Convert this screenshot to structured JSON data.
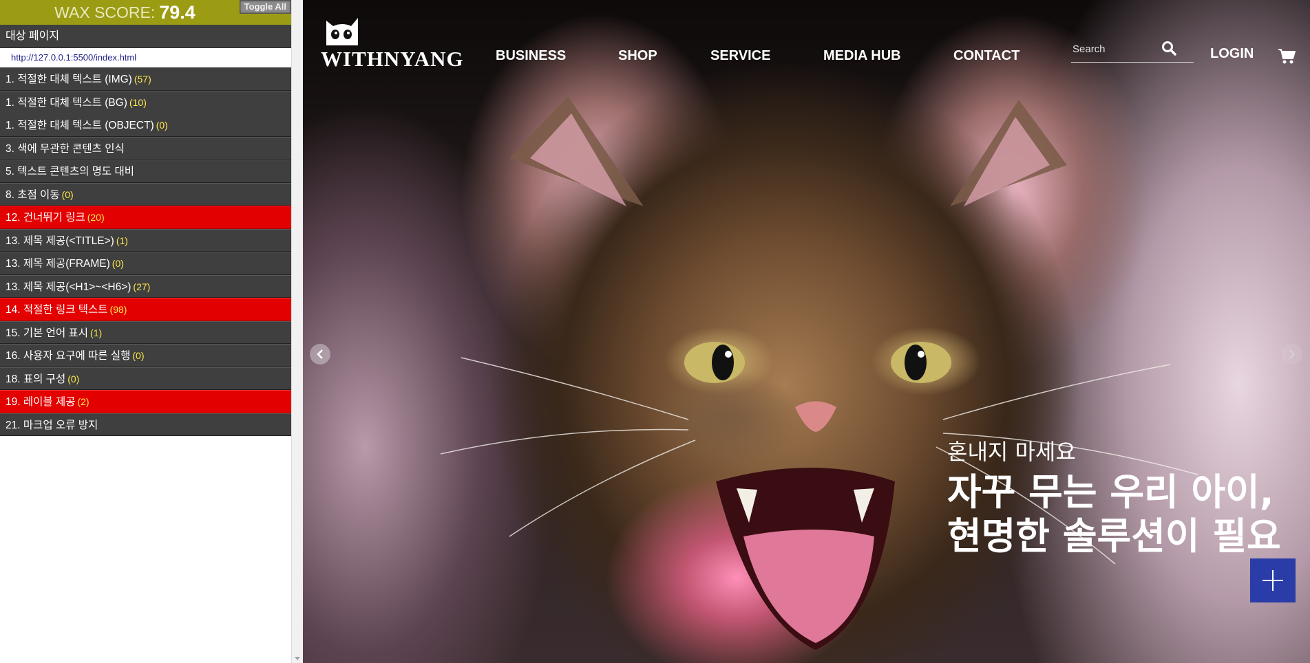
{
  "wax": {
    "score_label": "WAX SCORE:",
    "score_value": "79.4",
    "toggle_all": "Toggle All",
    "target_page_label": "대상 페이지",
    "target_url": "http://127.0.0.1:5500/index.html",
    "items": [
      {
        "label": "1. 적절한 대체 텍스트 (IMG)",
        "count": "(57)",
        "status": "normal"
      },
      {
        "label": "1. 적절한 대체 텍스트 (BG)",
        "count": "(10)",
        "status": "normal"
      },
      {
        "label": "1. 적절한 대체 텍스트 (OBJECT)",
        "count": "(0)",
        "status": "normal"
      },
      {
        "label": "3. 색에 무관한 콘텐츠 인식",
        "count": "",
        "status": "normal"
      },
      {
        "label": "5. 텍스트 콘텐츠의 명도 대비",
        "count": "",
        "status": "normal"
      },
      {
        "label": "8. 초점 이동",
        "count": "(0)",
        "status": "normal"
      },
      {
        "label": "12. 건너뛰기 링크",
        "count": "(20)",
        "status": "error"
      },
      {
        "label": "13. 제목 제공(<TITLE>)",
        "count": "(1)",
        "status": "normal"
      },
      {
        "label": "13. 제목 제공(FRAME)",
        "count": "(0)",
        "status": "normal"
      },
      {
        "label": "13. 제목 제공(<H1>~<H6>)",
        "count": "(27)",
        "status": "normal"
      },
      {
        "label": "14. 적절한 링크 텍스트",
        "count": "(98)",
        "status": "error"
      },
      {
        "label": "15. 기본 언어 표시",
        "count": "(1)",
        "status": "normal"
      },
      {
        "label": "16. 사용자 요구에 따른 실행",
        "count": "(0)",
        "status": "normal"
      },
      {
        "label": "18. 표의 구성",
        "count": "(0)",
        "status": "normal"
      },
      {
        "label": "19. 레이블 제공",
        "count": "(2)",
        "status": "error"
      },
      {
        "label": "21. 마크업 오류 방지",
        "count": "",
        "status": "normal"
      }
    ]
  },
  "site": {
    "logo_text": "WITHNYANG",
    "nav": [
      "BUSINESS",
      "SHOP",
      "SERVICE",
      "MEDIA HUB",
      "CONTACT"
    ],
    "search_placeholder": "Search",
    "login_label": "LOGIN",
    "hero": {
      "subtitle": "혼내지 마세요",
      "title_line1": "자꾸 무는 우리 아이,",
      "title_line2": "현명한 솔루션이 필요"
    },
    "icons": {
      "search": "search-icon",
      "cart": "cart-icon",
      "prev": "chevron-left-icon",
      "next": "chevron-right-icon",
      "plus": "plus-icon"
    },
    "colors": {
      "wax_score_bg": "#9c9c14",
      "wax_item_bg": "#3f3f3f",
      "wax_error_bg": "#e30000",
      "count_color": "#ffe94a",
      "plus_button_bg": "#2a3ca8"
    }
  }
}
